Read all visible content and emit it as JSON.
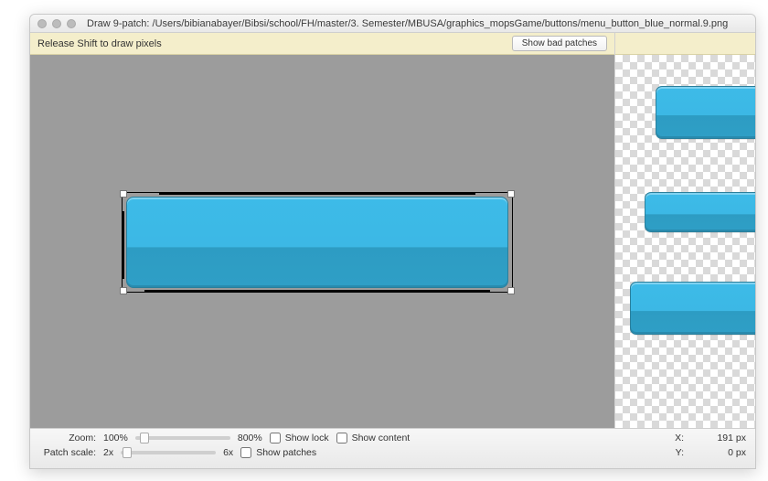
{
  "window": {
    "title": "Draw 9-patch: /Users/bibianabayer/Bibsi/school/FH/master/3. Semester/MBUSA/graphics_mopsGame/buttons/menu_button_blue_normal.9.png"
  },
  "toolbar": {
    "hint": "Release Shift to draw pixels",
    "show_bad_patches": "Show bad patches"
  },
  "status": {
    "zoom_label": "Zoom:",
    "zoom_min": "100%",
    "zoom_max": "800%",
    "zoom_thumb_pct": 5,
    "patch_label": "Patch scale:",
    "patch_min": "2x",
    "patch_max": "6x",
    "patch_thumb_pct": 2,
    "show_lock": "Show lock",
    "show_content": "Show content",
    "show_patches": "Show patches",
    "x_label": "X:",
    "x_value": "191 px",
    "y_label": "Y:",
    "y_value": "0 px"
  }
}
